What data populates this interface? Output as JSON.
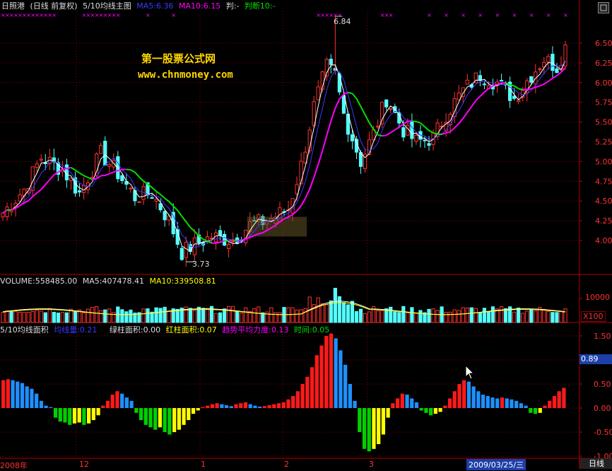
{
  "main_header": {
    "stock_name": "日照港",
    "period_info": "(日线 前复权)",
    "indicator_name": "5/10均线主图",
    "ma5": "MA5:6.36",
    "ma10": "MA10:6.15",
    "judge": "判:-",
    "judge10": "判断10:-"
  },
  "watermark": {
    "line1": "第一股票公式网",
    "line2": "www.chnmoney.com"
  },
  "price_annotations": {
    "high": "6.84",
    "low": "3.73"
  },
  "price_axis": [
    "6.50",
    "6.25",
    "6.00",
    "5.75",
    "5.50",
    "5.25",
    "5.00",
    "4.75",
    "4.50",
    "4.25",
    "4.00"
  ],
  "volume_header": {
    "volume": "VOLUME:558485.00",
    "ma5": "MA5:407478.41",
    "ma10": "MA10:339508.81"
  },
  "volume_axis": {
    "tick": "10000",
    "unit": "X100"
  },
  "area_header": {
    "name": "5/10均线面积",
    "junxian": "均线量:0.21",
    "green_area": "绿柱面积:0.00",
    "red_area": "红柱面积:0.07",
    "trend": "趋势平均力度:0.13",
    "time": "时间:0.05"
  },
  "area_axis": [
    "1.50",
    "1.00",
    "0.50",
    "0.00",
    "-0.50",
    "-1.00"
  ],
  "area_current_value": "0.89",
  "date_axis": {
    "labels": [
      "2008年",
      "12",
      "1",
      "2",
      "3"
    ],
    "cursor_date": "2009/03/25/三",
    "period_button": "日线"
  },
  "colors": {
    "up": "#ff3232",
    "down": "#54ffff",
    "ma5": "#3a3aff",
    "ma10_up": "#ff00ff",
    "ma10_down": "#00e000",
    "grid": "#8b0000",
    "white": "#ffffff",
    "yellow": "#ffff00",
    "area_red": "#ff1a1a",
    "area_blue": "#1e90ff",
    "area_green": "#00d000",
    "area_yellow": "#ffff00",
    "area_lime": "#aaff00"
  }
}
